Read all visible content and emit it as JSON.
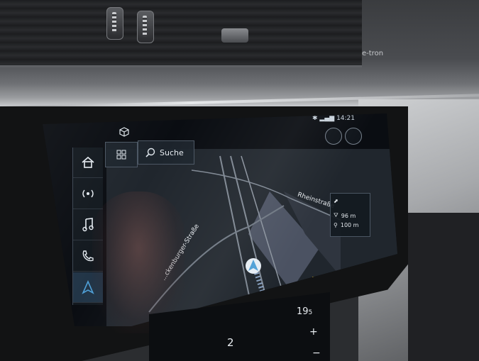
{
  "status_bar": {
    "time": "14:21"
  },
  "search": {
    "label": "Suche"
  },
  "map": {
    "streets": [
      {
        "name": "Rheinstraße"
      },
      {
        "name": "...ckenburger-Straße"
      }
    ]
  },
  "guidance": {
    "distance_1": "96 m",
    "distance_2": "100 m"
  },
  "climate": {
    "temperature": "19",
    "temperature_decimal": "5",
    "fan_level": "2"
  },
  "dashboard": {
    "badge": "e-tron"
  },
  "colors": {
    "accent": "#4f9fd6",
    "screen_bg": "#0a0d12",
    "map_bg": "#20262d"
  }
}
